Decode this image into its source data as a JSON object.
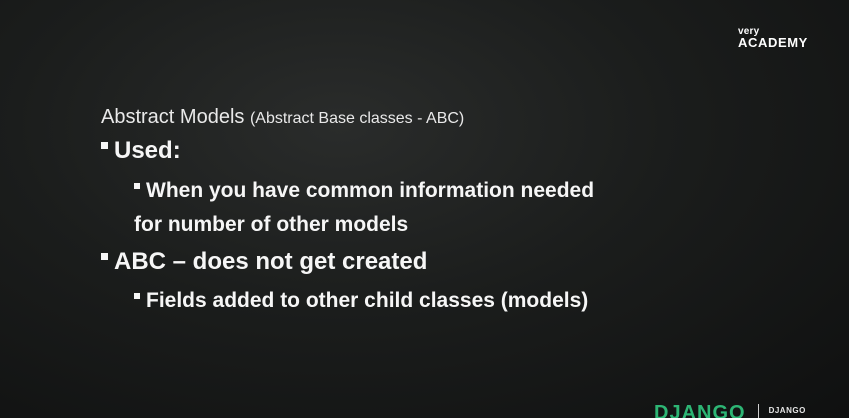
{
  "logo": {
    "small": "very",
    "big": "ACADEMY"
  },
  "slide": {
    "title_main": "Abstract Models",
    "title_sub": "(Abstract Base classes - ABC)",
    "bullets": [
      {
        "text": "Used:",
        "children": [
          {
            "line1": "When you have common information needed",
            "line2": "for number of other models"
          }
        ]
      },
      {
        "text": "ABC – does not get created",
        "children": [
          {
            "line1": "Fields added to other child classes (models)"
          }
        ]
      }
    ]
  },
  "footer": {
    "brand": "DJANGO",
    "small": "DJANGO"
  }
}
